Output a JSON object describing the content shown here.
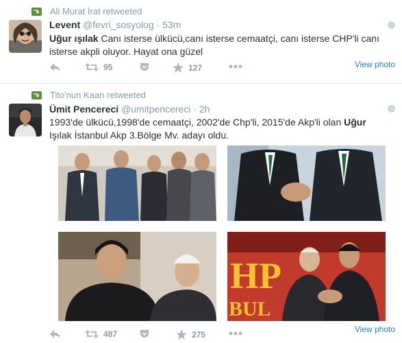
{
  "tweets": [
    {
      "retweeted_by": "Ali Murat İrat retweeted",
      "author_name": "Levent",
      "author_handle": "@fevri_sosyolog",
      "time": "· 53m",
      "text_bold_lead": "Uğur ışılak",
      "text_rest": " Canı isterse ülkücü,canı isterse cemaatçi, canı isterse CHP'li canı isterse akpli oluyor. Hayat ona güzel",
      "retweets": "95",
      "favorites": "127",
      "view_photo": "View photo"
    },
    {
      "retweeted_by": "Tito'nun Kaan retweeted",
      "author_name": "Ümit Pencereci",
      "author_handle": "@umitpencereci",
      "time": "· 2h",
      "text_lead": "1993'de ülkücü,1998'de cemaatçi, 2002'de Chp'li, 2015'de Akp'li olan ",
      "text_bold": "Uğur",
      "text_rest": " Işılak İstanbul Akp 3.Bölge Mv. adayı oldu.",
      "photo_text_1": "HP",
      "photo_text_2": "BUL",
      "retweets": "487",
      "favorites": "275",
      "view_photo": "View photo"
    }
  ],
  "colors": {
    "retweet_green": "#5c913b",
    "link_blue": "#2b7bb9",
    "meta_grey": "#8899a6",
    "text": "#292f33"
  },
  "icons": [
    "retweet-icon",
    "reply-icon",
    "favorite-star-icon",
    "pocket-icon",
    "more-dots-icon",
    "caret-icon"
  ]
}
